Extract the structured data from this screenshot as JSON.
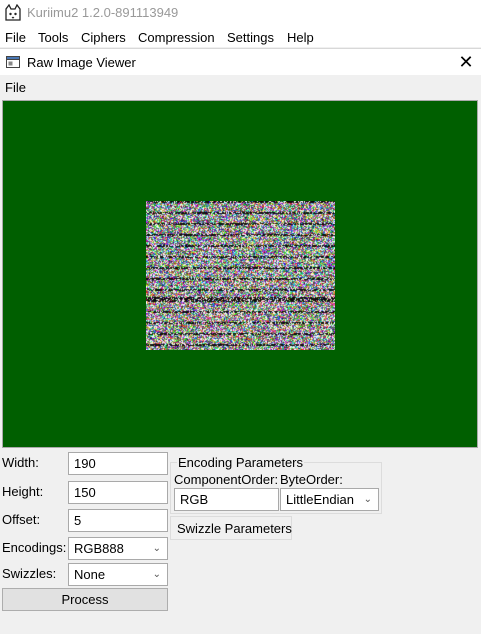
{
  "app": {
    "title": "Kuriimu2 1.2.0-891113949"
  },
  "menubar": {
    "items": [
      "File",
      "Tools",
      "Ciphers",
      "Compression",
      "Settings",
      "Help"
    ]
  },
  "window": {
    "title": "Raw Image Viewer",
    "close_glyph": "✕",
    "file_menu": "File"
  },
  "form": {
    "width_label": "Width:",
    "width_value": "190",
    "height_label": "Height:",
    "height_value": "150",
    "offset_label": "Offset:",
    "offset_value": "5",
    "encodings_label": "Encodings:",
    "encodings_value": "RGB888",
    "swizzles_label": "Swizzles:",
    "swizzles_value": "None",
    "process_label": "Process"
  },
  "encoding_params": {
    "title": "Encoding Parameters",
    "component_order_label": "ComponentOrder:",
    "component_order_value": "RGB",
    "byte_order_label": "ByteOrder:",
    "byte_order_value": "LittleEndian"
  },
  "swizzle_params": {
    "title": "Swizzle Parameters"
  },
  "colors": {
    "canvas_background": "#005f00"
  },
  "icons": {
    "app": "cat-icon",
    "window": "window-icon",
    "dropdown": "chevron-down-icon"
  }
}
